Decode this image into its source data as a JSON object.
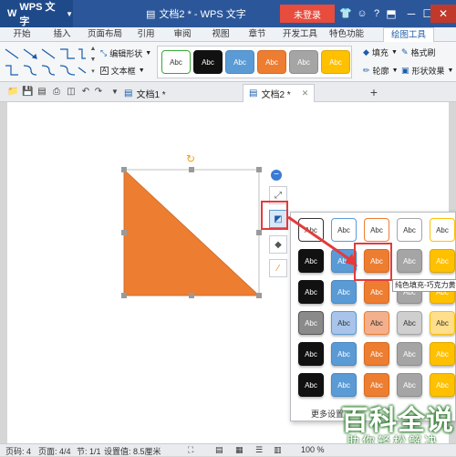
{
  "app": {
    "name": "WPS 文字",
    "dropdown_icon": "chevron-down-icon"
  },
  "titlebar": {
    "doc_title": "文档2 * - WPS 文字",
    "login_label": "未登录"
  },
  "menu": {
    "tabs": [
      "开始",
      "插入",
      "页面布局",
      "引用",
      "审阅",
      "视图",
      "章节",
      "开发工具",
      "特色功能",
      "绘图工具"
    ],
    "active_index": 9
  },
  "ribbon": {
    "edit_shape_label": "编辑形状",
    "text_box_label": "文本框",
    "style_swatch_label": "Abc",
    "styles": [
      {
        "bg": "#ffffff",
        "fg": "#333333",
        "border": "#3aa83a"
      },
      {
        "bg": "#111111",
        "fg": "#ffffff",
        "border": "#111111"
      },
      {
        "bg": "#5b9bd5",
        "fg": "#ffffff",
        "border": "#4a88c2"
      },
      {
        "bg": "#ed7d31",
        "fg": "#ffffff",
        "border": "#d96a1f"
      },
      {
        "bg": "#a5a5a5",
        "fg": "#ffffff",
        "border": "#8e8e8e"
      },
      {
        "bg": "#ffc000",
        "fg": "#ffffff",
        "border": "#e0a800"
      }
    ],
    "fill_label": "填充",
    "format_brush_label": "格式刷",
    "outline_label": "轮廓",
    "shape_effect_label": "形状效果"
  },
  "doc_tabs": [
    {
      "label": "文档1 *",
      "active": false
    },
    {
      "label": "文档2 *",
      "active": true
    }
  ],
  "shape": {
    "type": "right-triangle",
    "fill": "#ed7d31"
  },
  "popup": {
    "swatch_label": "Abc",
    "rows": [
      [
        "#ffffff|#333333|#333333",
        "#ffffff|#333333|#5b9bd5",
        "#ffffff|#333333|#ed7d31",
        "#ffffff|#333333|#a5a5a5",
        "#ffffff|#333333|#ffc000"
      ],
      [
        "#111111|#ffffff|#111111",
        "#5b9bd5|#ffffff|#4a88c2",
        "#ed7d31|#ffffff|#d96a1f",
        "#a5a5a5|#ffffff|#8e8e8e",
        "#ffc000|#ffffff|#e0a800"
      ],
      [
        "#111111|#ffffff|#111111",
        "#5b9bd5|#ffffff|#4a88c2",
        "#ed7d31|#ffffff|#d96a1f",
        "#a5a5a5|#ffffff|#8e8e8e",
        "#ffc000|#ffffff|#e0a800"
      ],
      [
        "#8a8a8a|#ffffff|#555555",
        "#a8c4ea|#333333|#5b9bd5",
        "#f4b08c|#333333|#ed7d31",
        "#cfcfcf|#333333|#a5a5a5",
        "#ffdf8c|#333333|#ffc000"
      ],
      [
        "#111111|#ffffff|#111111",
        "#5b9bd5|#ffffff|#4a88c2",
        "#ed7d31|#ffffff|#d96a1f",
        "#a5a5a5|#ffffff|#8e8e8e",
        "#ffc000|#ffffff|#e0a800"
      ],
      [
        "#111111|#ffffff|#111111",
        "#5b9bd5|#ffffff|#4a88c2",
        "#ed7d31|#ffffff|#d96a1f",
        "#a5a5a5|#ffffff|#8e8e8e",
        "#ffc000|#ffffff|#e0a800"
      ]
    ],
    "more_label": "更多设置",
    "tooltip": "纯色填充-巧克力黄"
  },
  "watermark": {
    "big": "百科全说",
    "small": "助你轻松解决"
  },
  "status": {
    "page_no": "页码: 4",
    "pages": "页面: 4/4",
    "section": "节: 1/1",
    "setting": "设置值: 8.5厘米",
    "zoom": "100 %"
  }
}
